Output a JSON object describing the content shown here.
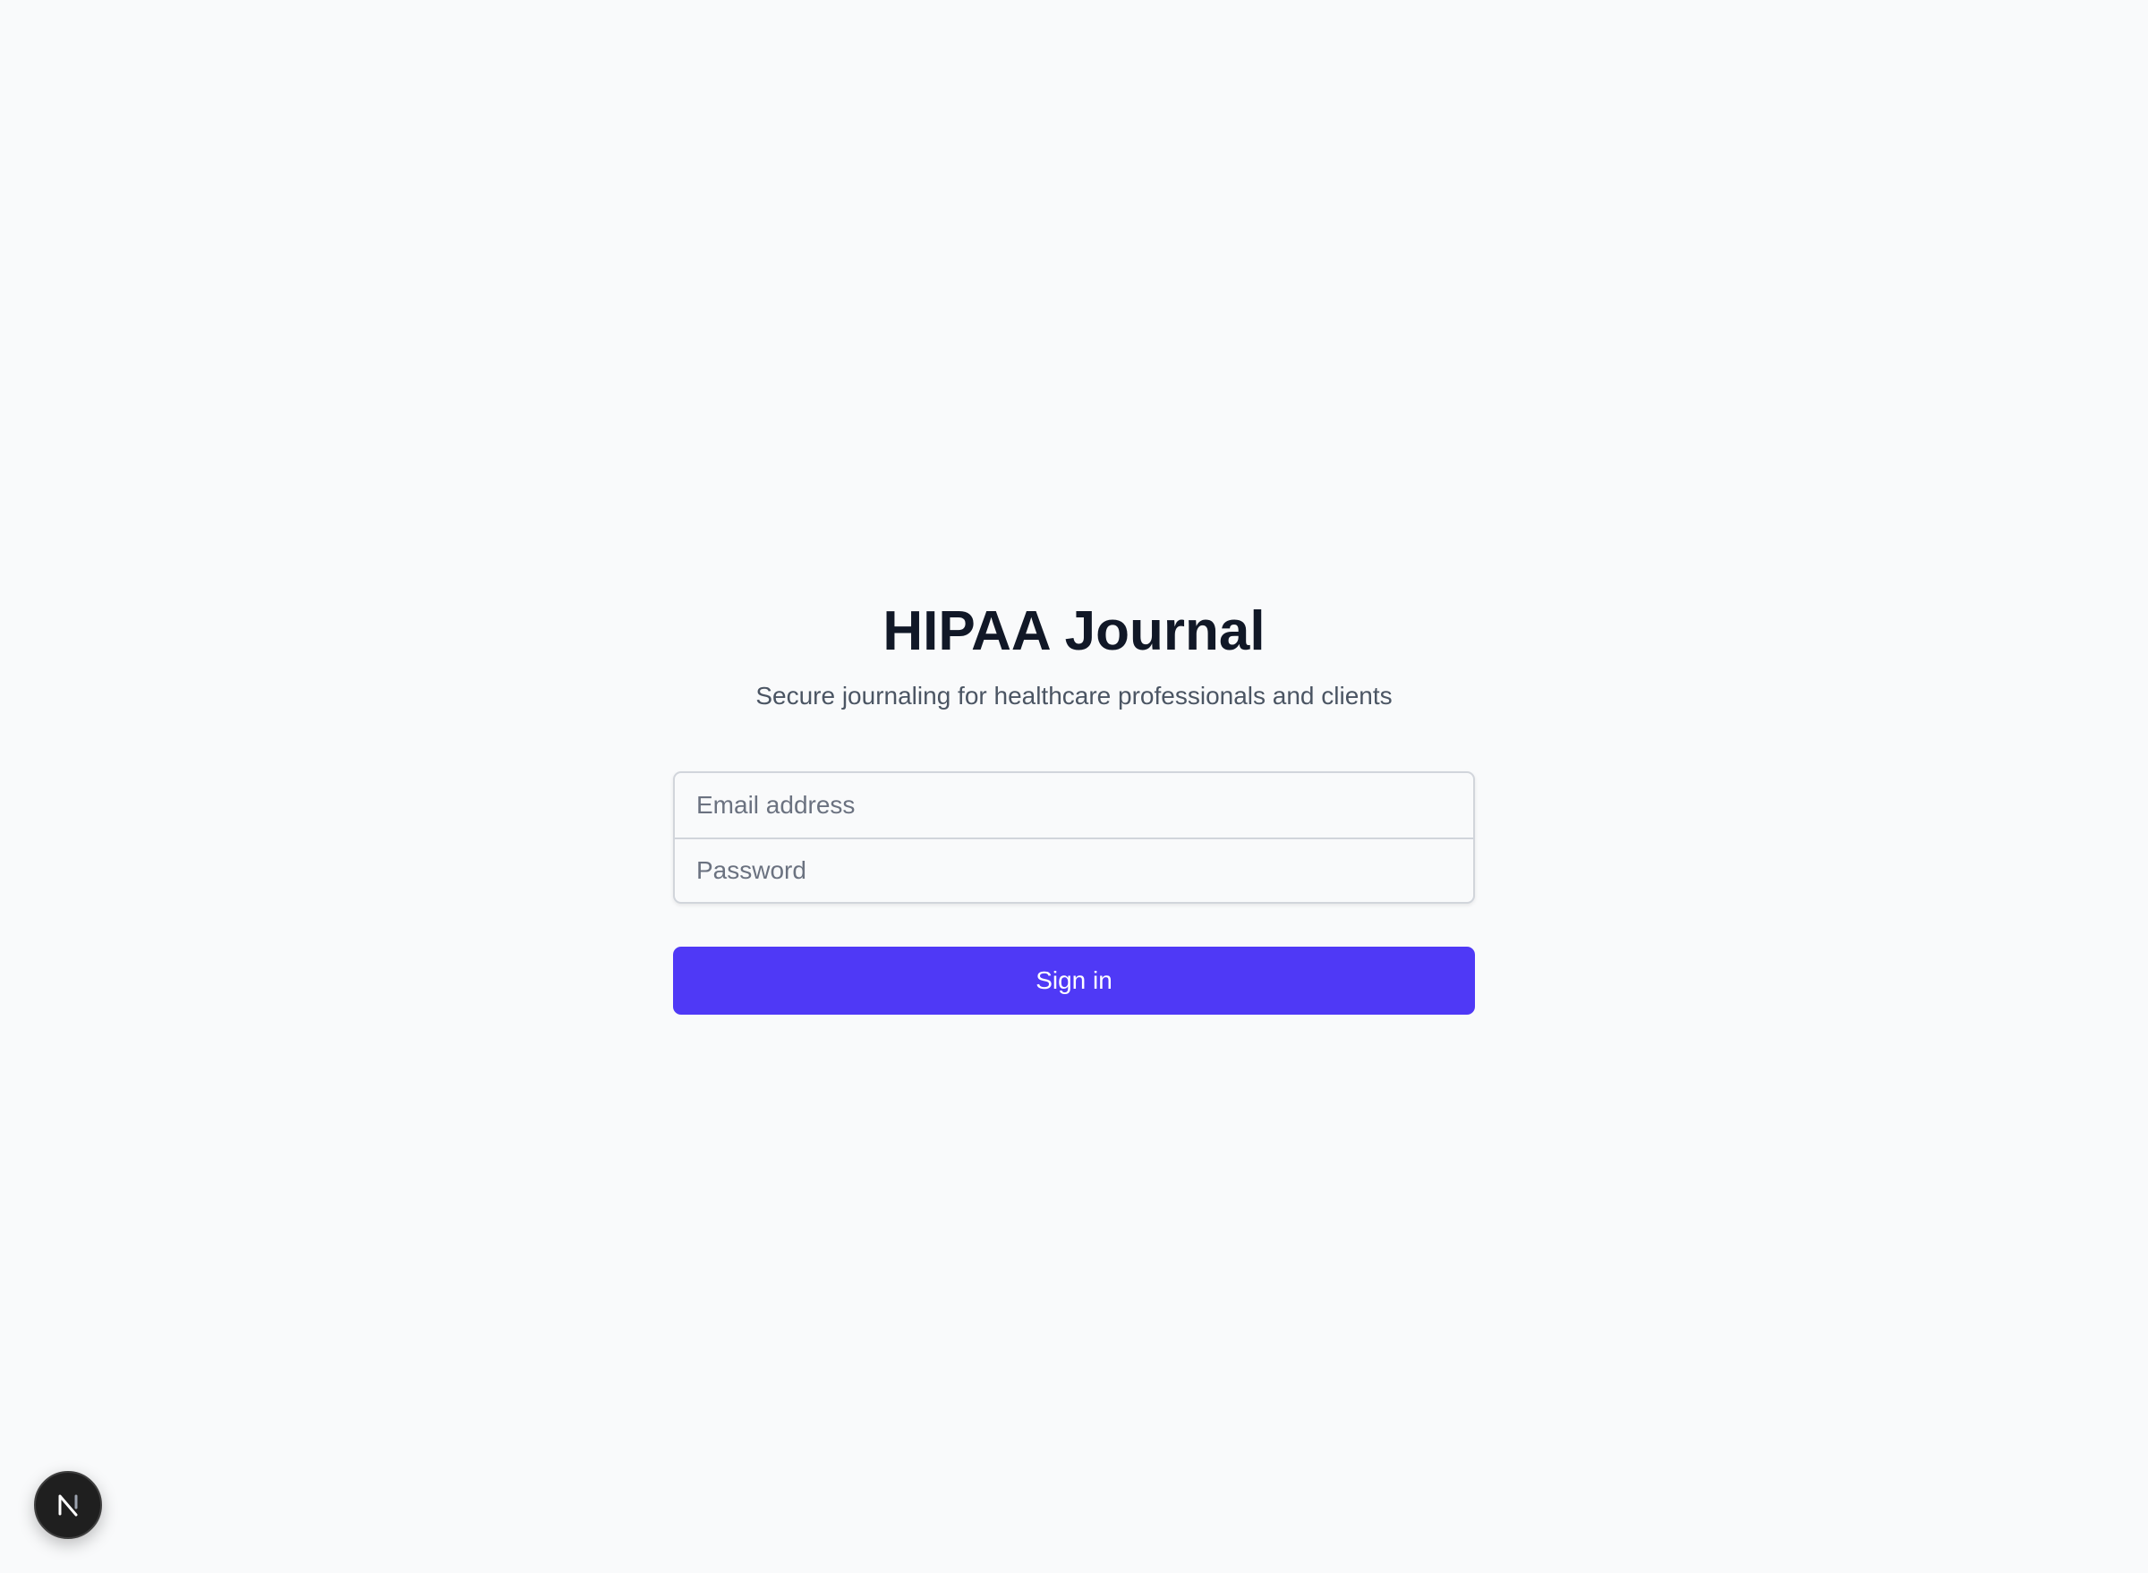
{
  "app": {
    "title": "HIPAA Journal",
    "subtitle": "Secure journaling for healthcare professionals and clients"
  },
  "form": {
    "email_placeholder": "Email address",
    "email_value": "",
    "password_placeholder": "Password",
    "password_value": "",
    "submit_label": "Sign in"
  },
  "dev_badge": {
    "icon": "nextjs-logo-icon"
  },
  "colors": {
    "background": "#f9fafb",
    "title": "#111827",
    "subtitle": "#4b5563",
    "primary_button": "#4f39f6",
    "badge": "#1f1f1f"
  }
}
